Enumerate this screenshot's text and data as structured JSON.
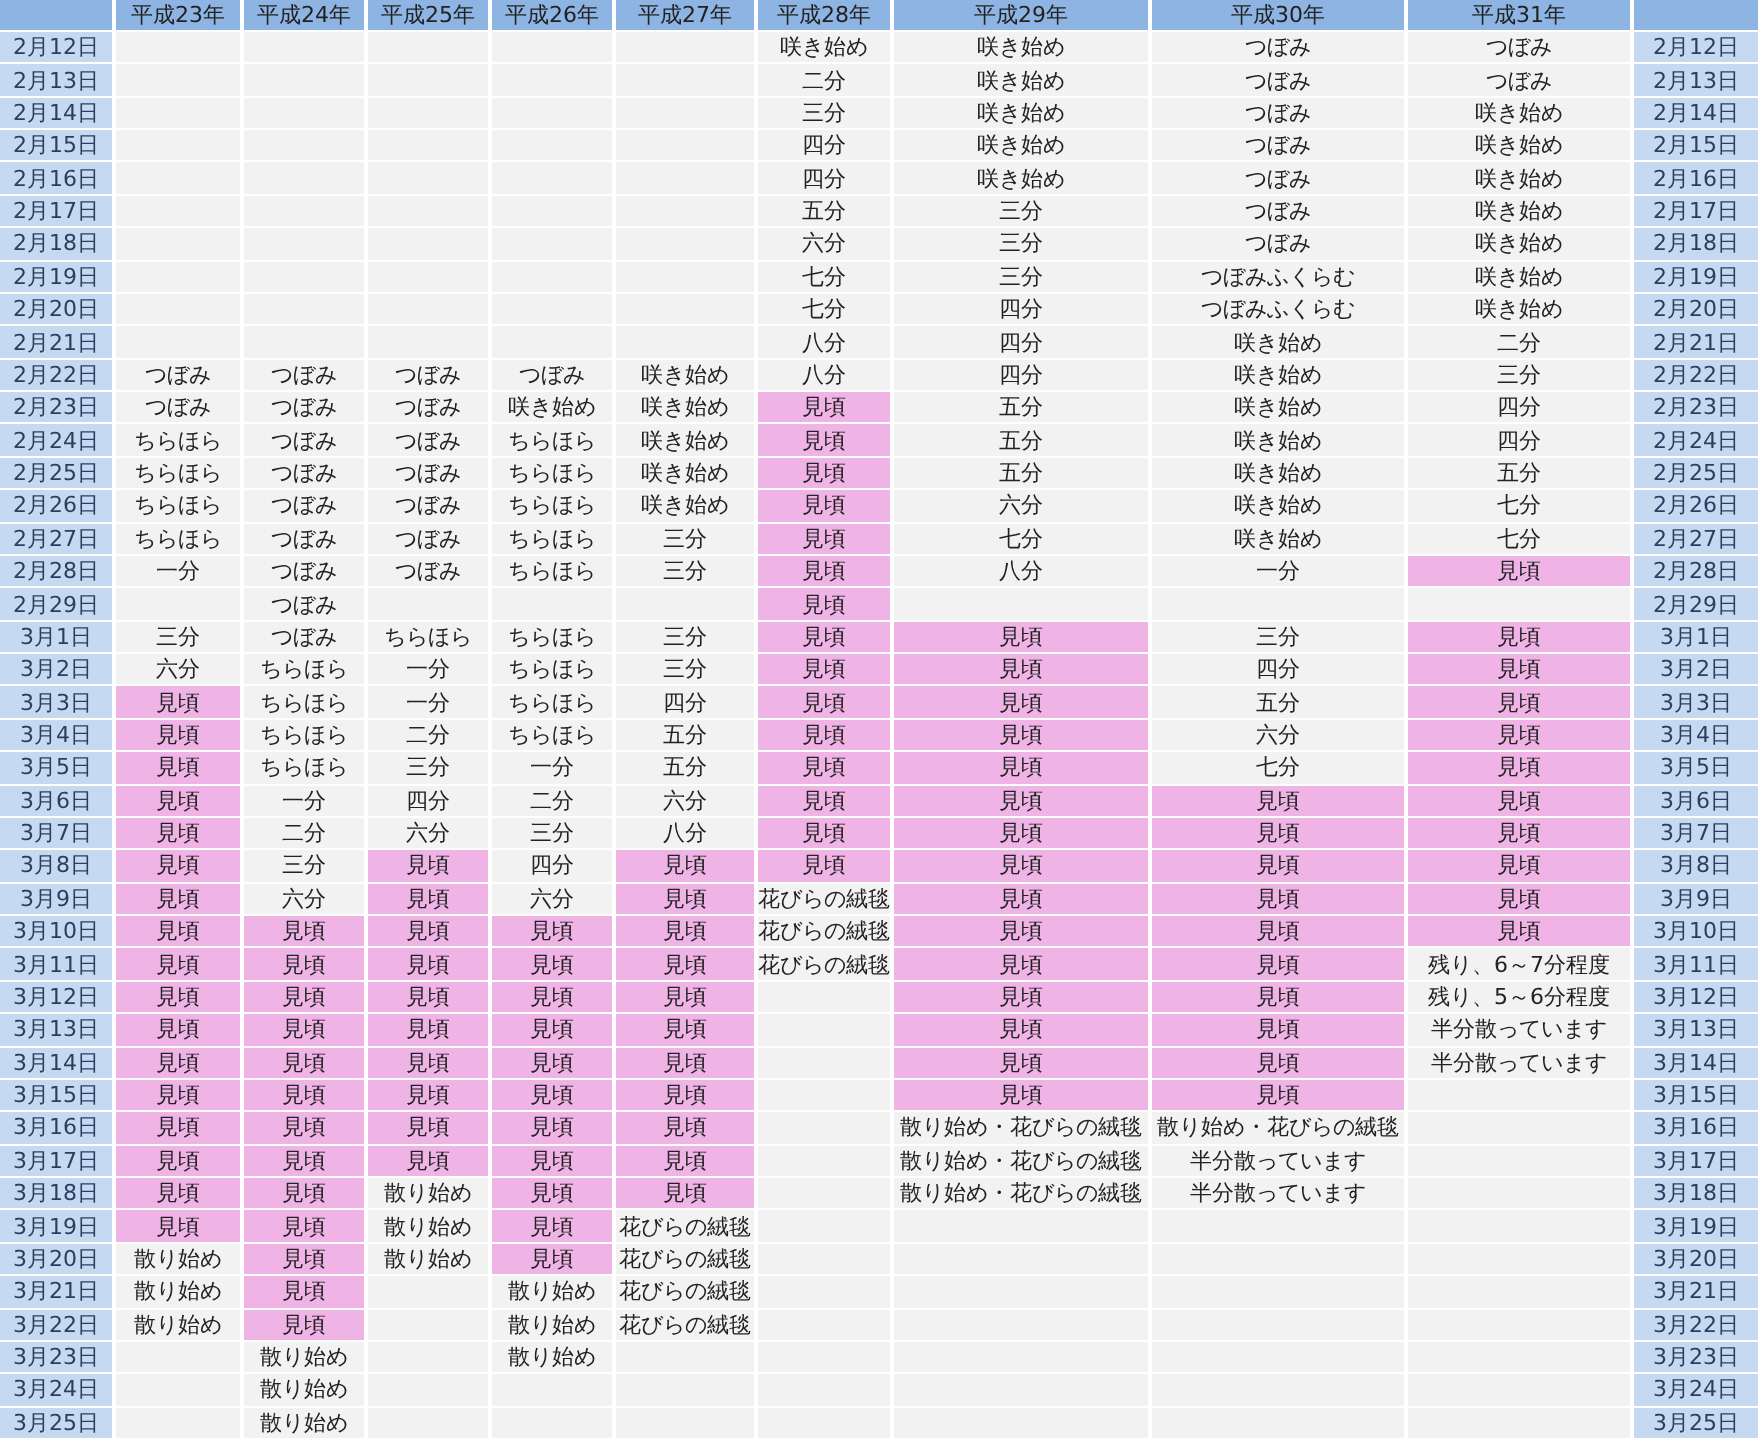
{
  "table": {
    "columns": [
      "平成23年",
      "平成24年",
      "平成25年",
      "平成26年",
      "平成27年",
      "平成28年",
      "平成29年",
      "平成30年",
      "平成31年"
    ],
    "rows": [
      {
        "date": "2月12日",
        "cells": [
          null,
          null,
          null,
          null,
          null,
          "咲き始め",
          "咲き始め",
          "つぼみ",
          "つぼみ"
        ],
        "highlighted": [
          false,
          false,
          false,
          false,
          false,
          false,
          false,
          false,
          false
        ],
        "date_end": "2月12日"
      },
      {
        "date": "2月13日",
        "cells": [
          null,
          null,
          null,
          null,
          null,
          "二分",
          "咲き始め",
          "つぼみ",
          "つぼみ"
        ],
        "highlighted": [
          false,
          false,
          false,
          false,
          false,
          false,
          false,
          false,
          false
        ],
        "date_end": "2月13日"
      },
      {
        "date": "2月14日",
        "cells": [
          null,
          null,
          null,
          null,
          null,
          "三分",
          "咲き始め",
          "つぼみ",
          "咲き始め"
        ],
        "highlighted": [
          false,
          false,
          false,
          false,
          false,
          false,
          false,
          false,
          false
        ],
        "date_end": "2月14日"
      },
      {
        "date": "2月15日",
        "cells": [
          null,
          null,
          null,
          null,
          null,
          "四分",
          "咲き始め",
          "つぼみ",
          "咲き始め"
        ],
        "highlighted": [
          false,
          false,
          false,
          false,
          false,
          false,
          false,
          false,
          false
        ],
        "date_end": "2月15日"
      },
      {
        "date": "2月16日",
        "cells": [
          null,
          null,
          null,
          null,
          null,
          "四分",
          "咲き始め",
          "つぼみ",
          "咲き始め"
        ],
        "highlighted": [
          false,
          false,
          false,
          false,
          false,
          false,
          false,
          false,
          false
        ],
        "date_end": "2月16日"
      },
      {
        "date": "2月17日",
        "cells": [
          null,
          null,
          null,
          null,
          null,
          "五分",
          "三分",
          "つぼみ",
          "咲き始め"
        ],
        "highlighted": [
          false,
          false,
          false,
          false,
          false,
          false,
          false,
          false,
          false
        ],
        "date_end": "2月17日"
      },
      {
        "date": "2月18日",
        "cells": [
          null,
          null,
          null,
          null,
          null,
          "六分",
          "三分",
          "つぼみ",
          "咲き始め"
        ],
        "highlighted": [
          false,
          false,
          false,
          false,
          false,
          false,
          false,
          false,
          false
        ],
        "date_end": "2月18日"
      },
      {
        "date": "2月19日",
        "cells": [
          null,
          null,
          null,
          null,
          null,
          "七分",
          "三分",
          "つぼみふくらむ",
          "咲き始め"
        ],
        "highlighted": [
          false,
          false,
          false,
          false,
          false,
          false,
          false,
          false,
          false
        ],
        "date_end": "2月19日"
      },
      {
        "date": "2月20日",
        "cells": [
          null,
          null,
          null,
          null,
          null,
          "七分",
          "四分",
          "つぼみふくらむ",
          "咲き始め"
        ],
        "highlighted": [
          false,
          false,
          false,
          false,
          false,
          false,
          false,
          false,
          false
        ],
        "date_end": "2月20日"
      },
      {
        "date": "2月21日",
        "cells": [
          null,
          null,
          null,
          null,
          null,
          "八分",
          "四分",
          "咲き始め",
          "二分"
        ],
        "highlighted": [
          false,
          false,
          false,
          false,
          false,
          false,
          false,
          false,
          false
        ],
        "date_end": "2月21日"
      },
      {
        "date": "2月22日",
        "cells": [
          "つぼみ",
          "つぼみ",
          "つぼみ",
          "つぼみ",
          "咲き始め",
          "八分",
          "四分",
          "咲き始め",
          "三分"
        ],
        "highlighted": [
          false,
          false,
          false,
          false,
          false,
          false,
          false,
          false,
          false
        ],
        "date_end": "2月22日"
      },
      {
        "date": "2月23日",
        "cells": [
          "つぼみ",
          "つぼみ",
          "つぼみ",
          "咲き始め",
          "咲き始め",
          "見頃",
          "五分",
          "咲き始め",
          "四分"
        ],
        "highlighted": [
          false,
          false,
          false,
          false,
          false,
          true,
          false,
          false,
          false
        ],
        "date_end": "2月23日"
      },
      {
        "date": "2月24日",
        "cells": [
          "ちらほら",
          "つぼみ",
          "つぼみ",
          "ちらほら",
          "咲き始め",
          "見頃",
          "五分",
          "咲き始め",
          "四分"
        ],
        "highlighted": [
          false,
          false,
          false,
          false,
          false,
          true,
          false,
          false,
          false
        ],
        "date_end": "2月24日"
      },
      {
        "date": "2月25日",
        "cells": [
          "ちらほら",
          "つぼみ",
          "つぼみ",
          "ちらほら",
          "咲き始め",
          "見頃",
          "五分",
          "咲き始め",
          "五分"
        ],
        "highlighted": [
          false,
          false,
          false,
          false,
          false,
          true,
          false,
          false,
          false
        ],
        "date_end": "2月25日"
      },
      {
        "date": "2月26日",
        "cells": [
          "ちらほら",
          "つぼみ",
          "つぼみ",
          "ちらほら",
          "咲き始め",
          "見頃",
          "六分",
          "咲き始め",
          "七分"
        ],
        "highlighted": [
          false,
          false,
          false,
          false,
          false,
          true,
          false,
          false,
          false
        ],
        "date_end": "2月26日"
      },
      {
        "date": "2月27日",
        "cells": [
          "ちらほら",
          "つぼみ",
          "つぼみ",
          "ちらほら",
          "三分",
          "見頃",
          "七分",
          "咲き始め",
          "七分"
        ],
        "highlighted": [
          false,
          false,
          false,
          false,
          false,
          true,
          false,
          false,
          false
        ],
        "date_end": "2月27日"
      },
      {
        "date": "2月28日",
        "cells": [
          "一分",
          "つぼみ",
          "つぼみ",
          "ちらほら",
          "三分",
          "見頃",
          "八分",
          "一分",
          "見頃"
        ],
        "highlighted": [
          false,
          false,
          false,
          false,
          false,
          true,
          false,
          false,
          true
        ],
        "date_end": "2月28日"
      },
      {
        "date": "2月29日",
        "cells": [
          null,
          "つぼみ",
          null,
          null,
          null,
          "見頃",
          null,
          null,
          null
        ],
        "highlighted": [
          false,
          false,
          false,
          false,
          false,
          true,
          false,
          false,
          false
        ],
        "date_end": "2月29日"
      },
      {
        "date": "3月1日",
        "cells": [
          "三分",
          "つぼみ",
          "ちらほら",
          "ちらほら",
          "三分",
          "見頃",
          "見頃",
          "三分",
          "見頃"
        ],
        "highlighted": [
          false,
          false,
          false,
          false,
          false,
          true,
          true,
          false,
          true
        ],
        "date_end": "3月1日"
      },
      {
        "date": "3月2日",
        "cells": [
          "六分",
          "ちらほら",
          "一分",
          "ちらほら",
          "三分",
          "見頃",
          "見頃",
          "四分",
          "見頃"
        ],
        "highlighted": [
          false,
          false,
          false,
          false,
          false,
          true,
          true,
          false,
          true
        ],
        "date_end": "3月2日"
      },
      {
        "date": "3月3日",
        "cells": [
          "見頃",
          "ちらほら",
          "一分",
          "ちらほら",
          "四分",
          "見頃",
          "見頃",
          "五分",
          "見頃"
        ],
        "highlighted": [
          true,
          false,
          false,
          false,
          false,
          true,
          true,
          false,
          true
        ],
        "date_end": "3月3日"
      },
      {
        "date": "3月4日",
        "cells": [
          "見頃",
          "ちらほら",
          "二分",
          "ちらほら",
          "五分",
          "見頃",
          "見頃",
          "六分",
          "見頃"
        ],
        "highlighted": [
          true,
          false,
          false,
          false,
          false,
          true,
          true,
          false,
          true
        ],
        "date_end": "3月4日"
      },
      {
        "date": "3月5日",
        "cells": [
          "見頃",
          "ちらほら",
          "三分",
          "一分",
          "五分",
          "見頃",
          "見頃",
          "七分",
          "見頃"
        ],
        "highlighted": [
          true,
          false,
          false,
          false,
          false,
          true,
          true,
          false,
          true
        ],
        "date_end": "3月5日"
      },
      {
        "date": "3月6日",
        "cells": [
          "見頃",
          "一分",
          "四分",
          "二分",
          "六分",
          "見頃",
          "見頃",
          "見頃",
          "見頃"
        ],
        "highlighted": [
          true,
          false,
          false,
          false,
          false,
          true,
          true,
          true,
          true
        ],
        "date_end": "3月6日"
      },
      {
        "date": "3月7日",
        "cells": [
          "見頃",
          "二分",
          "六分",
          "三分",
          "八分",
          "見頃",
          "見頃",
          "見頃",
          "見頃"
        ],
        "highlighted": [
          true,
          false,
          false,
          false,
          false,
          true,
          true,
          true,
          true
        ],
        "date_end": "3月7日"
      },
      {
        "date": "3月8日",
        "cells": [
          "見頃",
          "三分",
          "見頃",
          "四分",
          "見頃",
          "見頃",
          "見頃",
          "見頃",
          "見頃"
        ],
        "highlighted": [
          true,
          false,
          true,
          false,
          true,
          true,
          true,
          true,
          true
        ],
        "date_end": "3月8日"
      },
      {
        "date": "3月9日",
        "cells": [
          "見頃",
          "六分",
          "見頃",
          "六分",
          "見頃",
          "花びらの絨毯",
          "見頃",
          "見頃",
          "見頃"
        ],
        "highlighted": [
          true,
          false,
          true,
          false,
          true,
          false,
          true,
          true,
          true
        ],
        "date_end": "3月9日"
      },
      {
        "date": "3月10日",
        "cells": [
          "見頃",
          "見頃",
          "見頃",
          "見頃",
          "見頃",
          "花びらの絨毯",
          "見頃",
          "見頃",
          "見頃"
        ],
        "highlighted": [
          true,
          true,
          true,
          true,
          true,
          false,
          true,
          true,
          true
        ],
        "date_end": "3月10日"
      },
      {
        "date": "3月11日",
        "cells": [
          "見頃",
          "見頃",
          "見頃",
          "見頃",
          "見頃",
          "花びらの絨毯",
          "見頃",
          "見頃",
          "残り、6～7分程度"
        ],
        "highlighted": [
          true,
          true,
          true,
          true,
          true,
          false,
          true,
          true,
          false
        ],
        "date_end": "3月11日"
      },
      {
        "date": "3月12日",
        "cells": [
          "見頃",
          "見頃",
          "見頃",
          "見頃",
          "見頃",
          null,
          "見頃",
          "見頃",
          "残り、5～6分程度"
        ],
        "highlighted": [
          true,
          true,
          true,
          true,
          true,
          false,
          true,
          true,
          false
        ],
        "date_end": "3月12日"
      },
      {
        "date": "3月13日",
        "cells": [
          "見頃",
          "見頃",
          "見頃",
          "見頃",
          "見頃",
          null,
          "見頃",
          "見頃",
          "半分散っています"
        ],
        "highlighted": [
          true,
          true,
          true,
          true,
          true,
          false,
          true,
          true,
          false
        ],
        "date_end": "3月13日"
      },
      {
        "date": "3月14日",
        "cells": [
          "見頃",
          "見頃",
          "見頃",
          "見頃",
          "見頃",
          null,
          "見頃",
          "見頃",
          "半分散っています"
        ],
        "highlighted": [
          true,
          true,
          true,
          true,
          true,
          false,
          true,
          true,
          false
        ],
        "date_end": "3月14日"
      },
      {
        "date": "3月15日",
        "cells": [
          "見頃",
          "見頃",
          "見頃",
          "見頃",
          "見頃",
          null,
          "見頃",
          "見頃",
          null
        ],
        "highlighted": [
          true,
          true,
          true,
          true,
          true,
          false,
          true,
          true,
          false
        ],
        "date_end": "3月15日"
      },
      {
        "date": "3月16日",
        "cells": [
          "見頃",
          "見頃",
          "見頃",
          "見頃",
          "見頃",
          null,
          "散り始め・花びらの絨毯",
          "散り始め・花びらの絨毯",
          null
        ],
        "highlighted": [
          true,
          true,
          true,
          true,
          true,
          false,
          false,
          false,
          false
        ],
        "date_end": "3月16日"
      },
      {
        "date": "3月17日",
        "cells": [
          "見頃",
          "見頃",
          "見頃",
          "見頃",
          "見頃",
          null,
          "散り始め・花びらの絨毯",
          "半分散っています",
          null
        ],
        "highlighted": [
          true,
          true,
          true,
          true,
          true,
          false,
          false,
          false,
          false
        ],
        "date_end": "3月17日"
      },
      {
        "date": "3月18日",
        "cells": [
          "見頃",
          "見頃",
          "散り始め",
          "見頃",
          "見頃",
          null,
          "散り始め・花びらの絨毯",
          "半分散っています",
          null
        ],
        "highlighted": [
          true,
          true,
          false,
          true,
          true,
          false,
          false,
          false,
          false
        ],
        "date_end": "3月18日"
      },
      {
        "date": "3月19日",
        "cells": [
          "見頃",
          "見頃",
          "散り始め",
          "見頃",
          "花びらの絨毯",
          null,
          null,
          null,
          null
        ],
        "highlighted": [
          true,
          true,
          false,
          true,
          false,
          false,
          false,
          false,
          false
        ],
        "date_end": "3月19日"
      },
      {
        "date": "3月20日",
        "cells": [
          "散り始め",
          "見頃",
          "散り始め",
          "見頃",
          "花びらの絨毯",
          null,
          null,
          null,
          null
        ],
        "highlighted": [
          false,
          true,
          false,
          true,
          false,
          false,
          false,
          false,
          false
        ],
        "date_end": "3月20日"
      },
      {
        "date": "3月21日",
        "cells": [
          "散り始め",
          "見頃",
          null,
          "散り始め",
          "花びらの絨毯",
          null,
          null,
          null,
          null
        ],
        "highlighted": [
          false,
          true,
          false,
          false,
          false,
          false,
          false,
          false,
          false
        ],
        "date_end": "3月21日"
      },
      {
        "date": "3月22日",
        "cells": [
          "散り始め",
          "見頃",
          null,
          "散り始め",
          "花びらの絨毯",
          null,
          null,
          null,
          null
        ],
        "highlighted": [
          false,
          true,
          false,
          false,
          false,
          false,
          false,
          false,
          false
        ],
        "date_end": "3月22日"
      },
      {
        "date": "3月23日",
        "cells": [
          null,
          "散り始め",
          null,
          "散り始め",
          null,
          null,
          null,
          null,
          null
        ],
        "highlighted": [
          false,
          false,
          false,
          false,
          false,
          false,
          false,
          false,
          false
        ],
        "date_end": "3月23日"
      },
      {
        "date": "3月24日",
        "cells": [
          null,
          "散り始め",
          null,
          null,
          null,
          null,
          null,
          null,
          null
        ],
        "highlighted": [
          false,
          false,
          false,
          false,
          false,
          false,
          false,
          false,
          false
        ],
        "date_end": "3月24日"
      },
      {
        "date": "3月25日",
        "cells": [
          null,
          "散り始め",
          null,
          null,
          null,
          null,
          null,
          null,
          null
        ],
        "highlighted": [
          false,
          false,
          false,
          false,
          false,
          false,
          false,
          false,
          false
        ],
        "date_end": "3月25日"
      }
    ]
  }
}
